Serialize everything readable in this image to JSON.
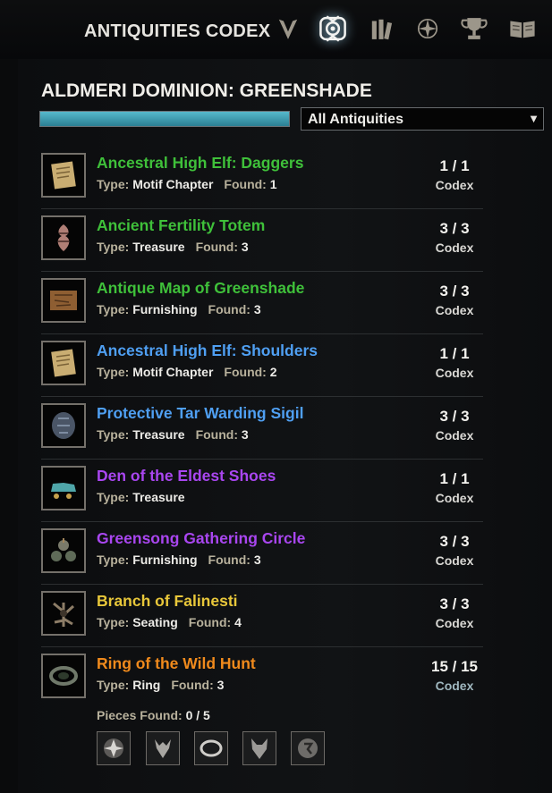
{
  "header": {
    "title": "ANTIQUITIES CODEX",
    "tabs": [
      {
        "icon": "dominion-emblem-icon",
        "active": false
      },
      {
        "icon": "antiquities-codex-icon",
        "active": true
      },
      {
        "icon": "books-icon",
        "active": false
      },
      {
        "icon": "compass-star-icon",
        "active": false
      },
      {
        "icon": "trophy-icon",
        "active": false
      },
      {
        "icon": "open-book-icon",
        "active": false
      }
    ]
  },
  "zone": {
    "title": "ALDMERI DOMINION: GREENSHADE",
    "progress": 1.0
  },
  "filter": {
    "selected": "All Antiquities"
  },
  "labels": {
    "type": "Type:",
    "found": "Found:",
    "pieces_found": "Pieces Found:"
  },
  "colors": {
    "fine": "#3fc03a",
    "superior": "#4f9ff2",
    "epic": "#a946f0",
    "legendary": "#e8c73a",
    "mythic": "#f08a1c",
    "progress": "#3c9fb4"
  },
  "antiquities": [
    {
      "name": "Ancestral High Elf: Daggers",
      "quality": "fine",
      "type": "Motif Chapter",
      "found": "1",
      "count": "1 / 1",
      "codex": "Codex",
      "icon": "scroll-icon"
    },
    {
      "name": "Ancient Fertility Totem",
      "quality": "fine",
      "type": "Treasure",
      "found": "3",
      "count": "3 / 3",
      "codex": "Codex",
      "icon": "totem-icon"
    },
    {
      "name": "Antique Map of Greenshade",
      "quality": "fine",
      "type": "Furnishing",
      "found": "3",
      "count": "3 / 3",
      "codex": "Codex",
      "icon": "map-icon"
    },
    {
      "name": "Ancestral High Elf: Shoulders",
      "quality": "superior",
      "type": "Motif Chapter",
      "found": "2",
      "count": "1 / 1",
      "codex": "Codex",
      "icon": "scroll-icon"
    },
    {
      "name": "Protective Tar Warding Sigil",
      "quality": "superior",
      "type": "Treasure",
      "found": "3",
      "count": "3 / 3",
      "codex": "Codex",
      "icon": "sigil-icon"
    },
    {
      "name": "Den of the Eldest Shoes",
      "quality": "epic",
      "type": "Treasure",
      "found": null,
      "count": "1 / 1",
      "codex": "Codex",
      "icon": "shoes-icon"
    },
    {
      "name": "Greensong Gathering Circle",
      "quality": "epic",
      "type": "Furnishing",
      "found": "3",
      "count": "3 / 3",
      "codex": "Codex",
      "icon": "stone-circle-icon"
    },
    {
      "name": "Branch of Falinesti",
      "quality": "legendary",
      "type": "Seating",
      "found": "4",
      "count": "3 / 3",
      "codex": "Codex",
      "icon": "branch-icon"
    },
    {
      "name": "Ring of the Wild Hunt",
      "quality": "mythic",
      "type": "Ring",
      "found": "3",
      "count": "15 / 15",
      "codex": "Codex",
      "icon": "ring-icon"
    }
  ],
  "mythic_pieces": {
    "found": "0 / 5",
    "pieces": [
      "wild-hunt-emblem-icon",
      "antler-pendant-icon",
      "ring-band-icon",
      "wolf-head-icon",
      "stone-rune-icon"
    ]
  }
}
